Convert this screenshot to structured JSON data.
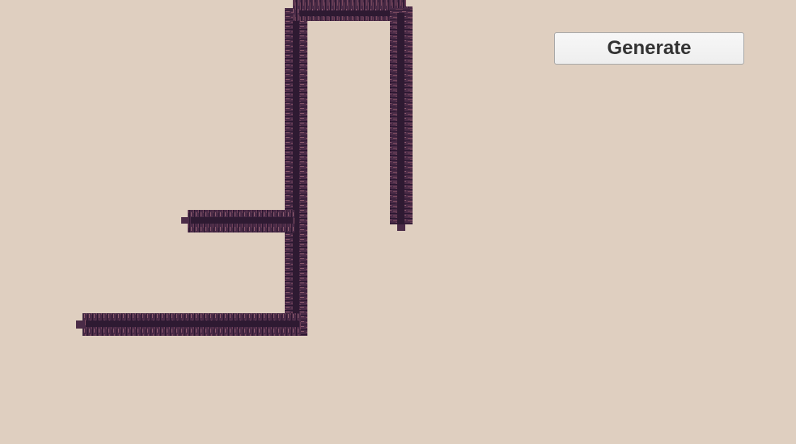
{
  "scene": {
    "background_color": "#dfcfc0",
    "corridor_colors": {
      "wall_dark": "#3f2540",
      "wall_mid": "#5a3552",
      "brick_accent": "#8a5a6c",
      "floor": "#2e1a32"
    }
  },
  "ui": {
    "generate_label": "Generate"
  }
}
